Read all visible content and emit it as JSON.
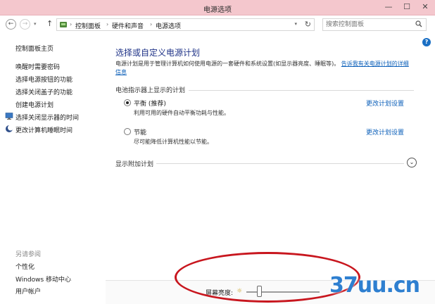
{
  "window": {
    "title": "电源选项",
    "minimize": "—",
    "maximize": "☐",
    "close": "✕"
  },
  "nav": {
    "back": "←",
    "forward": "→",
    "forward_dropdown": "▾",
    "up": "↑",
    "breadcrumbs": [
      "控制面板",
      "硬件和声音",
      "电源选项"
    ],
    "separator": "›",
    "address_dropdown": "▾",
    "refresh": "↻",
    "search_placeholder": "搜索控制面板",
    "search_icon": "search-icon"
  },
  "help_label": "?",
  "sidebar": {
    "items": [
      {
        "label": "控制面板主页",
        "icon": null
      },
      {
        "label": "唤醒时需要密码",
        "icon": null
      },
      {
        "label": "选择电源按钮的功能",
        "icon": null
      },
      {
        "label": "选择关闭盖子的功能",
        "icon": null
      },
      {
        "label": "创建电源计划",
        "icon": null
      },
      {
        "label": "选择关闭显示器的时间",
        "icon": "monitor-icon"
      },
      {
        "label": "更改计算机睡眠时间",
        "icon": "moon-icon"
      }
    ],
    "see_also_heading": "另请参阅",
    "see_also": [
      "个性化",
      "Windows 移动中心",
      "用户帐户"
    ]
  },
  "main": {
    "title": "选择或自定义电源计划",
    "intro": "电源计划是用于管理计算机如何使用电源的一套硬件和系统设置(如显示器亮度、睡眠等)。",
    "intro_link": "告诉我有关电源计划的详细信息",
    "section_heading": "电池指示器上显示的计划",
    "plans": [
      {
        "name": "平衡 (推荐)",
        "description": "利用可用的硬件自动平衡功耗与性能。",
        "selected": true,
        "change_link": "更改计划设置"
      },
      {
        "name": "节能",
        "description": "尽可能降低计算机性能以节能。",
        "selected": false,
        "change_link": "更改计划设置"
      }
    ],
    "extra_plans_heading": "显示附加计划",
    "expand_icon": "⌄"
  },
  "bottom": {
    "brightness_label": "屏幕亮度:",
    "brightness_level": 0.18
  },
  "colors": {
    "titlebar": "#f4c7cd",
    "link": "#0b5fb9",
    "heading": "#1e3287",
    "annotation": "#c8161e",
    "watermark": "#2e7fd0"
  },
  "watermark": "37uu.cn"
}
